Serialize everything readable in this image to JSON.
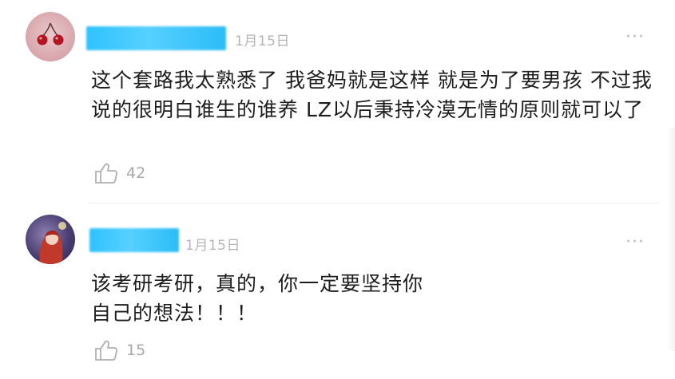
{
  "comments": [
    {
      "date": "1月15日",
      "more": "···",
      "text": "这个套路我太熟悉了 我爸妈就是这样 就是为了要男孩 不过我说的很明白谁生的谁养 LZ以后秉持冷漠无情的原则就可以了",
      "likes": "42"
    },
    {
      "date": "1月15日",
      "more": "···",
      "text": "该考研考研，真的，你一定要坚持你自己的想法！！！",
      "likes": "15"
    }
  ],
  "colors": {
    "name_mask": "#2fc2ff",
    "muted": "#b4b4b4",
    "text": "#1d1d1d"
  }
}
